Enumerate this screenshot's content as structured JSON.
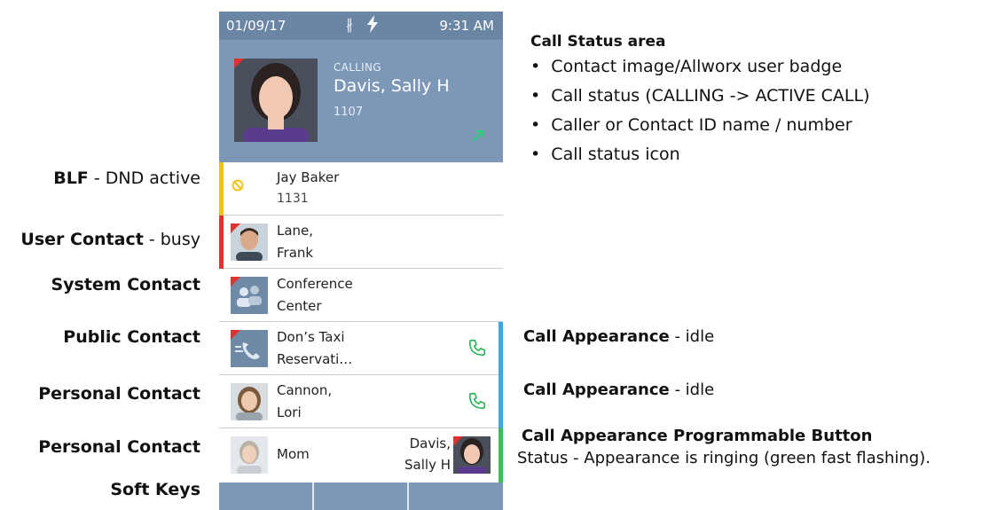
{
  "annotations_left": [
    {
      "bold": "BLF",
      "rest": " - DND active"
    },
    {
      "bold": "User Contact",
      "rest": " - busy"
    },
    {
      "bold": "System Contact",
      "rest": ""
    },
    {
      "bold": "Public Contact",
      "rest": ""
    },
    {
      "bold": "Personal Contact",
      "rest": ""
    },
    {
      "bold": "Personal Contact",
      "rest": ""
    },
    {
      "bold": "Soft Keys",
      "rest": ""
    }
  ],
  "call_status_area": {
    "heading": "Call Status area",
    "bullets": [
      "Contact image/Allworx user badge",
      "Call status (CALLING -> ACTIVE CALL)",
      "Caller or Contact ID name / number",
      "Call status icon"
    ]
  },
  "annotations_right": [
    {
      "bold": "Call Appearance",
      "rest": " - idle"
    },
    {
      "bold": "Call Appearance",
      "rest": " - idle"
    },
    {
      "bold": "Call Appearance Programmable Button",
      "rest": "",
      "detail": "Status - Appearance is ringing (green fast flashing)."
    }
  ],
  "phone": {
    "status_bar": {
      "date": "01/09/17",
      "time": "9:31 AM",
      "icons": [
        "bluetooth-icon",
        "lightning-icon"
      ]
    },
    "call": {
      "status": "CALLING",
      "name": "Davis, Sally H",
      "number": "1107",
      "icon": "outgoing-arrow-icon"
    },
    "rows": [
      {
        "line1": "Jay Baker",
        "line2": "1131",
        "left_bar": "#f0c419",
        "icon": "dnd-icon"
      },
      {
        "line1": "Lane,",
        "line2": "Frank",
        "left_bar": "#e0302f",
        "icon": "male-avatar"
      },
      {
        "line1": "Conference",
        "line2": "Center",
        "left_bar": "",
        "icon": "conference-icon"
      },
      {
        "line1": "Don’s Taxi",
        "line2": "Reservati…",
        "left_bar": "",
        "icon": "public-phone-icon",
        "right_bar": "#3ba8de"
      },
      {
        "line1": "Cannon,",
        "line2": "Lori",
        "left_bar": "",
        "icon": "female-avatar",
        "right_bar": "#3ba8de"
      },
      {
        "line1": "Mom",
        "line2": "",
        "left_bar": "",
        "icon": "mom-avatar",
        "right_bar": "#3cbf58",
        "right_name_1": "Davis,",
        "right_name_2": "Sally H"
      }
    ],
    "colors": {
      "accent": "#7c98b6",
      "green": "#2fb35a",
      "red": "#e0302f",
      "yellow": "#f0c419",
      "blue": "#3ba8de"
    }
  }
}
